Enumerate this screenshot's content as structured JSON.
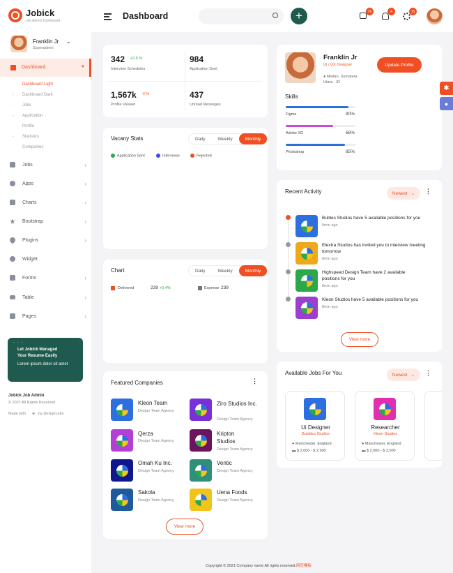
{
  "brand": {
    "name": "Jobick",
    "tagline": "Job Admin Dashboard"
  },
  "header": {
    "title": "Dashboard",
    "badges": [
      "76",
      "4",
      "15"
    ]
  },
  "user": {
    "name": "Franklin Jr",
    "role": "Superadmin"
  },
  "sidebar": {
    "dashboard": "Dashboard",
    "subitems": [
      "Dashboard Light",
      "Dashboard Dark",
      "Jobs",
      "Application",
      "Profile",
      "Statistics",
      "Companies"
    ],
    "items": [
      "Jobs",
      "Apps",
      "Charts",
      "Bootstrap",
      "Plugins",
      "Widget",
      "Forms",
      "Table",
      "Pages"
    ],
    "promo": {
      "line1": "Let Jobick Managed",
      "line2": "Your Resume Easily",
      "line3": "Lorem ipsum dolor sit amet"
    },
    "footer": {
      "app": "Jobick Job Admin",
      "copy": "© 2021 All Rights Reserved",
      "made_pre": "Made with",
      "made_post": "by DexignLabs"
    }
  },
  "stats": [
    {
      "value": "342",
      "change": "+0.5 %",
      "label": "Interview Schedules"
    },
    {
      "value": "984",
      "change": "",
      "label": "Application Sent"
    },
    {
      "value": "1,567k",
      "change": "-2 %",
      "label": "Profile Viewed"
    },
    {
      "value": "437",
      "change": "",
      "label": "Unread Messages"
    }
  ],
  "vacancy": {
    "title": "Vacany Stats",
    "tabs": [
      "Daily",
      "Weekly",
      "Monthly"
    ],
    "legend": [
      "Application Sent",
      "Interviews",
      "Rejected"
    ]
  },
  "chart": {
    "title": "Chart",
    "tabs": [
      "Daily",
      "Weekly",
      "Monthly"
    ],
    "delivered": "Delivered",
    "delivered_val": "239",
    "delivered_change": "+0.4%",
    "expense": "Expense",
    "expense_val": "239"
  },
  "companies": {
    "title": "Featured Companies",
    "view_more": "View more",
    "items": [
      {
        "name": "Kleon Team",
        "sub": "Design Team Agency",
        "color": "#2d6fe0"
      },
      {
        "name": "Ziro Studios Inc.",
        "sub": "Design Team Agency",
        "color": "#7b2fd6"
      },
      {
        "name": "Qerza",
        "sub": "Design Team Agency",
        "color": "#b43fd6"
      },
      {
        "name": "Kripton Studios",
        "sub": "Design Team Agency",
        "color": "#6b1460"
      },
      {
        "name": "Omah Ku Inc.",
        "sub": "Design Team Agency",
        "color": "#10168f"
      },
      {
        "name": "Ventic",
        "sub": "Design Team Agency",
        "color": "#2f8f7a"
      },
      {
        "name": "Sakola",
        "sub": "Design Team Agency",
        "color": "#1e5a9e"
      },
      {
        "name": "Uena Foods",
        "sub": "Design Team Agency",
        "color": "#f0c419"
      }
    ]
  },
  "profile": {
    "name": "Franklin Jr",
    "role": "UI / UX Designer",
    "location": "Medan, Sumatera Utara - ID",
    "button": "Update Profile",
    "skills_title": "Skills",
    "skills": [
      {
        "name": "Figma",
        "pct": "90%",
        "value": 90,
        "color": "#2d6fe0"
      },
      {
        "name": "Adobe XD",
        "pct": "68%",
        "value": 68,
        "color": "#c94ad6"
      },
      {
        "name": "Photoshop",
        "pct": "85%",
        "value": 85,
        "color": "#2d6fe0"
      }
    ]
  },
  "activity": {
    "title": "Recent Activity",
    "filter": "Newest",
    "view_more": "View more",
    "items": [
      {
        "text": "Bubles Studios have 5 available positions for you",
        "time": "8min ago",
        "color": "#2d6fe0"
      },
      {
        "text": "Elextra Studios has invited you to interview meeting tomorrow",
        "time": "8min ago",
        "color": "#f0a81b"
      },
      {
        "text": "Highspeed Design Team have 2 available positions for you",
        "time": "8min ago",
        "color": "#2aa84a"
      },
      {
        "text": "Kleon Studios have 5 available positions for you",
        "time": "8min ago",
        "color": "#9b3fd0"
      }
    ]
  },
  "jobs": {
    "title": "Available Jobs For You",
    "filter": "Newest",
    "items": [
      {
        "title": "Ui Designer",
        "company": "Bubbles Studios",
        "location": "Manchester, England",
        "salary": "$ 2,000 - $ 2,500",
        "color": "#2d6fe0"
      },
      {
        "title": "Researcher",
        "company": "Kleon Studios",
        "location": "Manchester, England",
        "salary": "$ 2,000 - $ 2,500",
        "color": "#e02fb0"
      }
    ]
  },
  "footer": {
    "text": "Copyright © 2021 Company name All rights reserved.",
    "brand": "网页模板"
  }
}
